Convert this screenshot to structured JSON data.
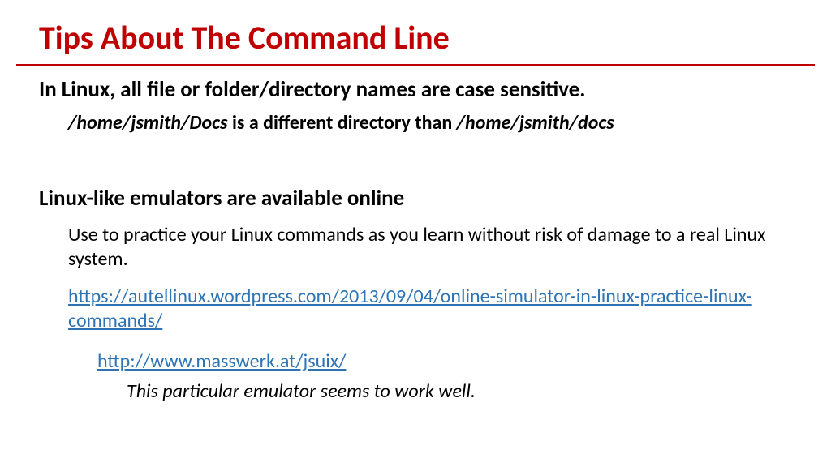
{
  "title": "Tips About The Command Line",
  "section1": {
    "heading": "In Linux, all file or folder/directory names are case sensitive.",
    "path1": "/home/jsmith/Docs",
    "between": " is a different directory than ",
    "path2": "/home/jsmith/docs"
  },
  "section2": {
    "heading": "Linux-like emulators are available online",
    "body": "Use to practice your Linux commands as you learn without risk of damage to a real Linux system.",
    "link1": "https://autellinux.wordpress.com/2013/09/04/online-simulator-in-linux-practice-linux-commands/",
    "link2": "http://www.masswerk.at/jsuix/",
    "note": "This particular emulator seems to work well."
  }
}
